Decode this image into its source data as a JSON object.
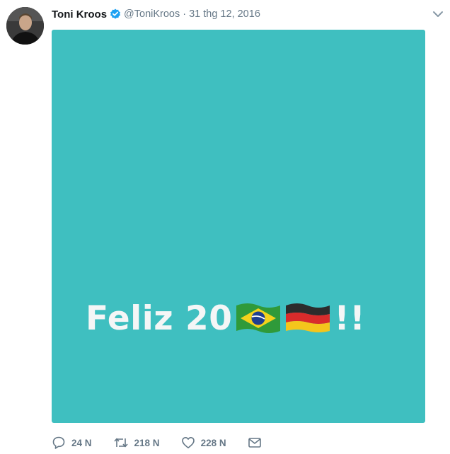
{
  "tweet": {
    "author_name": "Toni Kroos",
    "handle": "@ToniKroos",
    "separator": "·",
    "date": "31 thg 12, 2016",
    "avatar_icon": "avatar-photo",
    "verified_icon": "verified-badge-icon",
    "menu_icon": "chevron-down-icon",
    "accent_color": "#1da1f2",
    "muted_color": "#657786"
  },
  "media": {
    "background_color": "#3fbfc0",
    "greeting_text": "Feliz 20",
    "greeting_suffix": "!!",
    "flags": [
      "brazil-flag-icon",
      "germany-flag-icon"
    ]
  },
  "actions": {
    "reply_count": "24 N",
    "retweet_count": "218 N",
    "like_count": "228 N",
    "icons": [
      "reply-icon",
      "retweet-icon",
      "like-icon",
      "direct-message-icon"
    ]
  }
}
